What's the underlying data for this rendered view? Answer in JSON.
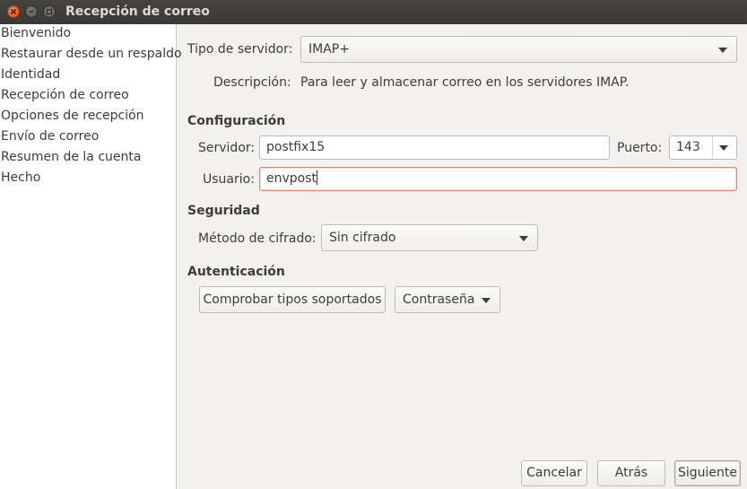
{
  "window": {
    "title": "Recepción de correo"
  },
  "sidebar": {
    "items": [
      {
        "label": "Bienvenido"
      },
      {
        "label": "Restaurar desde un respaldo"
      },
      {
        "label": "Identidad"
      },
      {
        "label": "Recepción de correo"
      },
      {
        "label": "Opciones de recepción"
      },
      {
        "label": "Envío de correo"
      },
      {
        "label": "Resumen de la cuenta"
      },
      {
        "label": "Hecho"
      }
    ]
  },
  "server_type": {
    "label": "Tipo de servidor:",
    "value": "IMAP+",
    "description_label": "Descripción:",
    "description": "Para leer y almacenar correo en los servidores IMAP."
  },
  "configuration": {
    "heading": "Configuración",
    "server_label": "Servidor:",
    "server_value": "postfix15",
    "port_label": "Puerto:",
    "port_value": "143",
    "user_label": "Usuario:",
    "user_value": "envpost"
  },
  "security": {
    "heading": "Seguridad",
    "encryption_label": "Método de cifrado:",
    "encryption_value": "Sin cifrado"
  },
  "authentication": {
    "heading": "Autenticación",
    "check_button": "Comprobar tipos soportados",
    "method_value": "Contraseña"
  },
  "footer": {
    "cancel": "Cancelar",
    "back": "Atrás",
    "next": "Siguiente"
  }
}
